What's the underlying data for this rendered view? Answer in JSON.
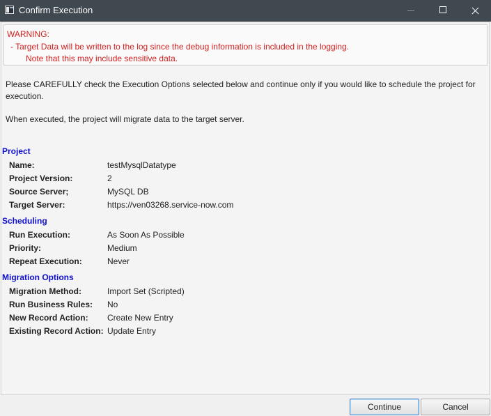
{
  "window": {
    "title": "Confirm Execution"
  },
  "warning": {
    "title": "WARNING:",
    "line1": "- Target Data will be written to the log since the debug information is included in the logging.",
    "line2": "Note that this may include sensitive data."
  },
  "intro": {
    "paragraph1": "Please CAREFULLY check the Execution Options selected  below and continue only if you would like to schedule the project for execution.",
    "paragraph2": "When executed, the project will migrate data to the target server."
  },
  "project": {
    "heading": "Project",
    "rows": [
      {
        "label": "Name:",
        "value": "testMysqlDatatype"
      },
      {
        "label": "Project Version:",
        "value": "2"
      },
      {
        "label": "Source Server;",
        "value": "MySQL DB"
      },
      {
        "label": "Target Server:",
        "value": "https://ven03268.service-now.com"
      }
    ]
  },
  "scheduling": {
    "heading": "Scheduling",
    "rows": [
      {
        "label": "Run Execution:",
        "value": "As Soon As Possible"
      },
      {
        "label": "Priority:",
        "value": "Medium"
      },
      {
        "label": "Repeat Execution:",
        "value": "Never"
      }
    ]
  },
  "migration": {
    "heading": "Migration Options",
    "rows": [
      {
        "label": "Migration Method:",
        "value": "Import Set (Scripted)"
      },
      {
        "label": "Run Business Rules:",
        "value": "No"
      },
      {
        "label": "New Record Action:",
        "value": "Create New Entry"
      },
      {
        "label": "Existing Record Action:",
        "value": "Update Entry"
      }
    ]
  },
  "buttons": {
    "continue": "Continue",
    "cancel": "Cancel"
  },
  "colors": {
    "titlebar": "#404850",
    "warning_text": "#d21f1f",
    "section_heading": "#1111cc",
    "default_button_border": "#4a8bc8"
  }
}
